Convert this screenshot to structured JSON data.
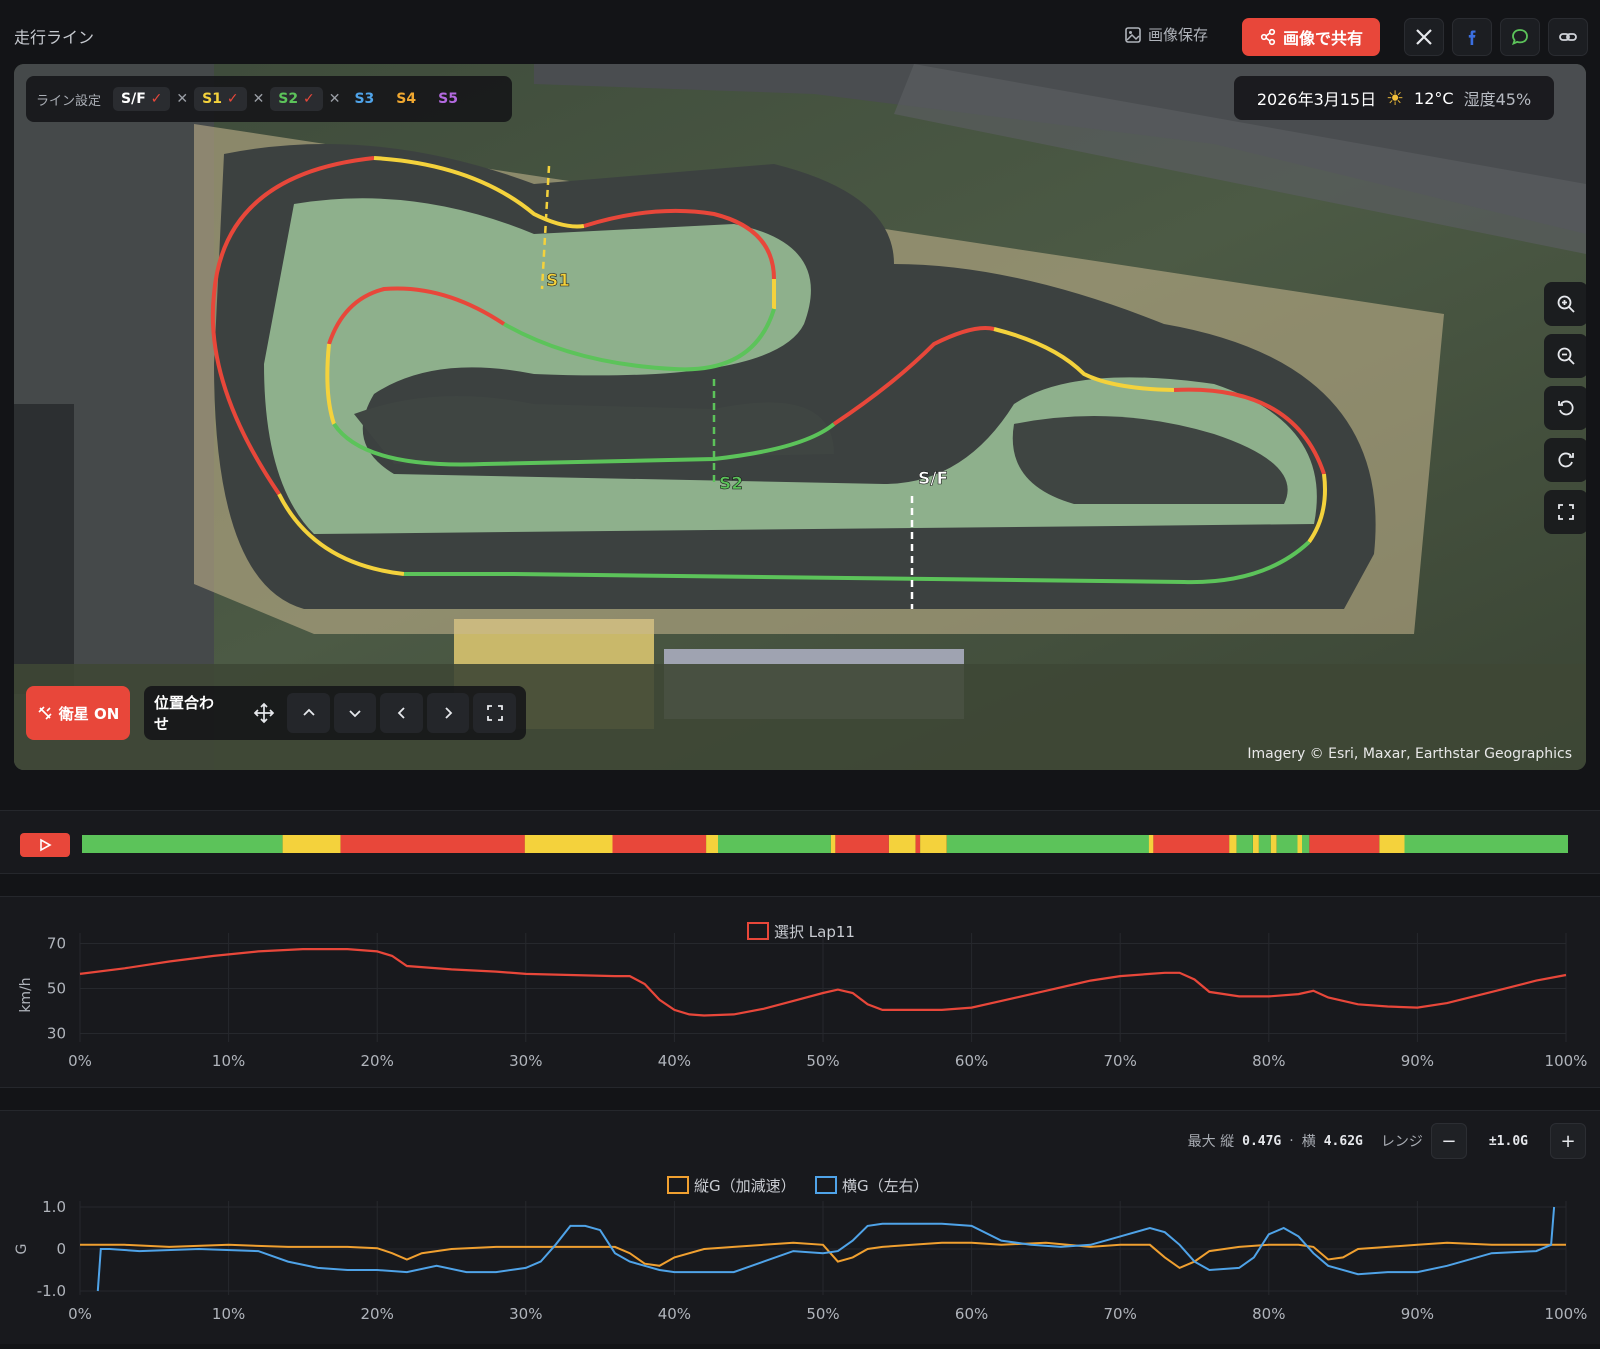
{
  "header": {
    "title": "走行ライン",
    "save_label": "画像保存",
    "share_label": "画像で共有"
  },
  "map": {
    "line_settings_label": "ライン設定",
    "lines": [
      {
        "label": "S/F",
        "color": "#ffffff",
        "set": true
      },
      {
        "label": "S1",
        "color": "#f4d23c",
        "set": true
      },
      {
        "label": "S2",
        "color": "#5cc35a",
        "set": true
      },
      {
        "label": "S3",
        "color": "#4fa3e8",
        "set": false
      },
      {
        "label": "S4",
        "color": "#f0a830",
        "set": false
      },
      {
        "label": "S5",
        "color": "#b36ae0",
        "set": false
      }
    ],
    "date": "2026年3月15日",
    "temperature": "12°C",
    "humidity": "湿度45%",
    "satellite_label": "衛星 ON",
    "align_label": "位置合わせ",
    "markers": {
      "s1": "S1",
      "s2": "S2",
      "sf": "S/F"
    },
    "attribution": "Imagery © Esri, Maxar, Earthstar Geographics"
  },
  "colors": {
    "green": "#5cc35a",
    "yellow": "#f4d23c",
    "red": "#e8473a",
    "accent": "#e8473a",
    "orange": "#f0a030",
    "blue": "#4fa3e8"
  },
  "timeline": {
    "segments": [
      [
        "green",
        0,
        13.5
      ],
      [
        "yellow",
        13.5,
        17.4
      ],
      [
        "red",
        17.4,
        29.8
      ],
      [
        "yellow",
        29.8,
        35.7
      ],
      [
        "red",
        35.7,
        42
      ],
      [
        "yellow",
        42,
        42.8
      ],
      [
        "green",
        42.8,
        50.4
      ],
      [
        "yellow",
        50.4,
        50.7
      ],
      [
        "red",
        50.7,
        54.3
      ],
      [
        "yellow",
        54.3,
        56.1
      ],
      [
        "red",
        56.1,
        56.4
      ],
      [
        "yellow",
        56.4,
        58.2
      ],
      [
        "green",
        58.2,
        71.8
      ],
      [
        "yellow",
        71.8,
        72.1
      ],
      [
        "red",
        72.1,
        77.2
      ],
      [
        "yellow",
        77.2,
        77.7
      ],
      [
        "green",
        77.7,
        78.8
      ],
      [
        "yellow",
        78.8,
        79.2
      ],
      [
        "green",
        79.2,
        80
      ],
      [
        "yellow",
        80,
        80.4
      ],
      [
        "green",
        80.4,
        81.8
      ],
      [
        "yellow",
        81.8,
        82.1
      ],
      [
        "green",
        82.1,
        82.6
      ],
      [
        "red",
        82.6,
        87.3
      ],
      [
        "yellow",
        87.3,
        89
      ],
      [
        "green",
        89,
        100
      ]
    ]
  },
  "speed_chart": {
    "legend": "選択 Lap11",
    "ylabel": "km/h",
    "yticks": [
      "70",
      "50",
      "30"
    ],
    "xticks": [
      "0%",
      "10%",
      "20%",
      "30%",
      "40%",
      "50%",
      "60%",
      "70%",
      "80%",
      "90%",
      "100%"
    ]
  },
  "g_chart": {
    "max_label": "最大 縦",
    "max_long": "0.47G",
    "separator": "·",
    "max_lat_label": "横",
    "max_lat": "4.62G",
    "range_label": "レンジ",
    "range_minus": "−",
    "range_value": "±1.0G",
    "range_plus": "+",
    "legend_long": "縦G（加減速）",
    "legend_lat": "横G（左右）",
    "ylabel": "G",
    "yticks": [
      "1.0",
      "0",
      "-1.0"
    ],
    "xticks": [
      "0%",
      "10%",
      "20%",
      "30%",
      "40%",
      "50%",
      "60%",
      "70%",
      "80%",
      "90%",
      "100%"
    ]
  },
  "chart_data": [
    {
      "type": "line",
      "legend": "選択 Lap11",
      "ylabel": "km/h",
      "ylim": [
        28,
        72
      ],
      "series": [
        {
          "name": "選択 Lap11",
          "x": [
            0,
            3,
            6,
            9,
            12,
            15,
            18,
            20,
            21,
            22,
            25,
            28,
            30,
            33,
            36,
            37,
            38,
            39,
            40,
            41,
            42,
            44,
            46,
            48,
            50,
            51,
            52,
            53,
            54,
            56,
            58,
            60,
            62,
            65,
            67,
            68,
            70,
            72,
            73,
            74,
            75,
            76,
            78,
            80,
            82,
            83,
            84,
            86,
            88,
            90,
            92,
            95,
            98,
            100
          ],
          "values": [
            56.5,
            59,
            62,
            64.5,
            66.5,
            67.5,
            67.5,
            66.5,
            64.5,
            60,
            58.5,
            57.5,
            56.5,
            56,
            55.5,
            55.5,
            52,
            45,
            40.5,
            38.5,
            38,
            38.5,
            41,
            44.5,
            48,
            49.5,
            48,
            43,
            40.5,
            40.5,
            40.5,
            41.5,
            44.5,
            49,
            52,
            53.5,
            55.5,
            56.5,
            57,
            57,
            54,
            48.5,
            46.5,
            46.5,
            47.5,
            49,
            46,
            43,
            42,
            41.5,
            43.5,
            48.5,
            53.5,
            56
          ]
        }
      ]
    },
    {
      "type": "line",
      "ylabel": "G",
      "ylim": [
        -1,
        1
      ],
      "series": [
        {
          "name": "縦G（加減速）",
          "x": [
            0,
            3,
            6,
            10,
            14,
            18,
            20,
            21,
            22,
            23,
            25,
            28,
            32,
            35,
            36,
            37,
            38,
            39,
            40,
            42,
            44,
            46,
            48,
            50,
            51,
            52,
            53,
            54,
            56,
            58,
            60,
            62,
            65,
            68,
            70,
            72,
            73,
            74,
            75,
            76,
            78,
            80,
            82,
            83,
            84,
            85,
            86,
            88,
            90,
            92,
            95,
            98,
            100
          ],
          "values": [
            0.1,
            0.1,
            0.05,
            0.1,
            0.05,
            0.05,
            0.02,
            -0.1,
            -0.25,
            -0.1,
            0.0,
            0.05,
            0.05,
            0.05,
            0.05,
            -0.1,
            -0.35,
            -0.4,
            -0.2,
            0.0,
            0.05,
            0.1,
            0.15,
            0.1,
            -0.3,
            -0.2,
            0.0,
            0.05,
            0.1,
            0.15,
            0.15,
            0.1,
            0.15,
            0.05,
            0.1,
            0.1,
            -0.2,
            -0.45,
            -0.3,
            -0.05,
            0.05,
            0.1,
            0.1,
            0.05,
            -0.25,
            -0.2,
            0.0,
            0.05,
            0.1,
            0.15,
            0.1,
            0.1,
            0.1
          ]
        },
        {
          "name": "横G（左右）",
          "x": [
            1.2,
            1.4,
            2,
            4,
            8,
            12,
            14,
            16,
            18,
            20,
            22,
            24,
            26,
            28,
            30,
            31,
            32,
            33,
            34,
            35,
            36,
            37,
            38,
            39,
            40,
            42,
            44,
            46,
            48,
            50,
            51,
            52,
            53,
            54,
            56,
            58,
            60,
            62,
            64,
            66,
            68,
            70,
            72,
            73,
            74,
            75,
            76,
            78,
            79,
            80,
            81,
            82,
            83,
            84,
            86,
            88,
            90,
            92,
            95,
            98,
            99,
            99.2
          ],
          "values": [
            -1.0,
            0.0,
            0.0,
            -0.05,
            0.0,
            -0.05,
            -0.3,
            -0.45,
            -0.5,
            -0.5,
            -0.55,
            -0.4,
            -0.55,
            -0.55,
            -0.45,
            -0.3,
            0.1,
            0.55,
            0.55,
            0.45,
            -0.1,
            -0.3,
            -0.4,
            -0.5,
            -0.55,
            -0.55,
            -0.55,
            -0.3,
            -0.05,
            -0.1,
            -0.05,
            0.2,
            0.55,
            0.6,
            0.6,
            0.6,
            0.55,
            0.2,
            0.1,
            0.05,
            0.1,
            0.3,
            0.5,
            0.4,
            0.1,
            -0.3,
            -0.5,
            -0.45,
            -0.2,
            0.35,
            0.5,
            0.3,
            -0.1,
            -0.4,
            -0.6,
            -0.55,
            -0.55,
            -0.4,
            -0.1,
            -0.05,
            0.1,
            1.0
          ]
        }
      ]
    }
  ]
}
